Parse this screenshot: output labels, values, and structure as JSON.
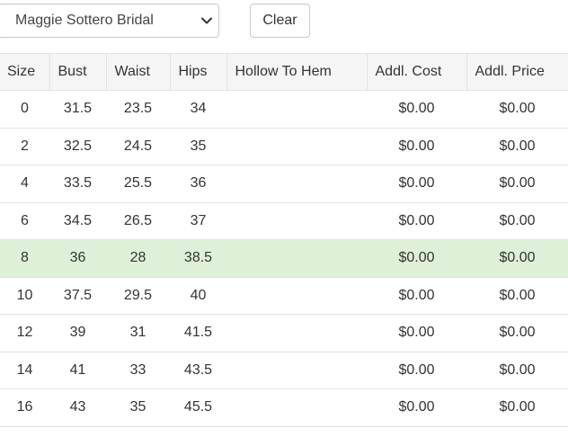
{
  "controls": {
    "designer_select_value": "Maggie Sottero Bridal",
    "clear_label": "Clear"
  },
  "table": {
    "headers": [
      "Size",
      "Bust",
      "Waist",
      "Hips",
      "Hollow To Hem",
      "Addl. Cost",
      "Addl. Price"
    ],
    "rows": [
      {
        "size": "0",
        "bust": "31.5",
        "waist": "23.5",
        "hips": "34",
        "hollow_to_hem": "",
        "addl_cost": "$0.00",
        "addl_price": "$0.00",
        "selected": false
      },
      {
        "size": "2",
        "bust": "32.5",
        "waist": "24.5",
        "hips": "35",
        "hollow_to_hem": "",
        "addl_cost": "$0.00",
        "addl_price": "$0.00",
        "selected": false
      },
      {
        "size": "4",
        "bust": "33.5",
        "waist": "25.5",
        "hips": "36",
        "hollow_to_hem": "",
        "addl_cost": "$0.00",
        "addl_price": "$0.00",
        "selected": false
      },
      {
        "size": "6",
        "bust": "34.5",
        "waist": "26.5",
        "hips": "37",
        "hollow_to_hem": "",
        "addl_cost": "$0.00",
        "addl_price": "$0.00",
        "selected": false
      },
      {
        "size": "8",
        "bust": "36",
        "waist": "28",
        "hips": "38.5",
        "hollow_to_hem": "",
        "addl_cost": "$0.00",
        "addl_price": "$0.00",
        "selected": true
      },
      {
        "size": "10",
        "bust": "37.5",
        "waist": "29.5",
        "hips": "40",
        "hollow_to_hem": "",
        "addl_cost": "$0.00",
        "addl_price": "$0.00",
        "selected": false
      },
      {
        "size": "12",
        "bust": "39",
        "waist": "31",
        "hips": "41.5",
        "hollow_to_hem": "",
        "addl_cost": "$0.00",
        "addl_price": "$0.00",
        "selected": false
      },
      {
        "size": "14",
        "bust": "41",
        "waist": "33",
        "hips": "43.5",
        "hollow_to_hem": "",
        "addl_cost": "$0.00",
        "addl_price": "$0.00",
        "selected": false
      },
      {
        "size": "16",
        "bust": "43",
        "waist": "35",
        "hips": "45.5",
        "hollow_to_hem": "",
        "addl_cost": "$0.00",
        "addl_price": "$0.00",
        "selected": false
      }
    ]
  },
  "colors": {
    "selected_row_bg": "#dff0d8",
    "header_bg": "#f5f5f5",
    "border": "#e2e2e2"
  },
  "icons": {
    "select_chevron": "chevron-down-icon"
  }
}
